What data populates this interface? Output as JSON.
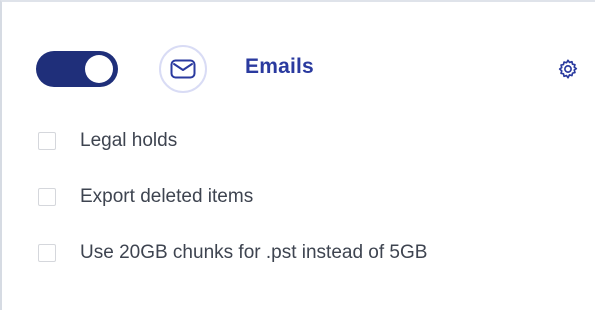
{
  "section": {
    "title": "Emails",
    "enabled": true,
    "colors": {
      "toggle_on": "#1f2f7a",
      "accent": "#2a3a9f",
      "icon_ring": "#d9dcf5"
    },
    "icons": {
      "main": "envelope-icon",
      "settings": "gear-icon"
    }
  },
  "options": [
    {
      "label": "Legal holds",
      "checked": false
    },
    {
      "label": "Export deleted items",
      "checked": false
    },
    {
      "label": "Use 20GB chunks for .pst instead of 5GB",
      "checked": false
    }
  ]
}
